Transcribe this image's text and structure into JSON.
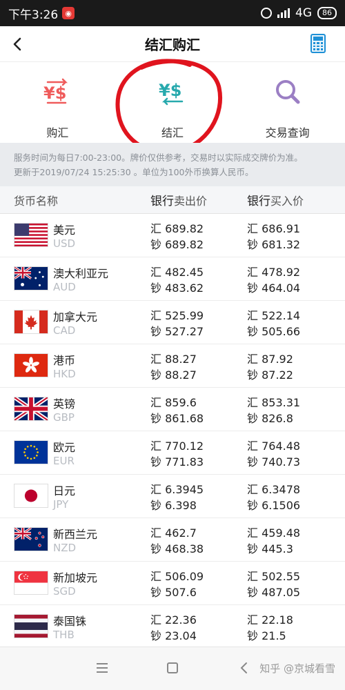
{
  "status": {
    "time": "下午3:26",
    "network": "4G",
    "battery": "86"
  },
  "header": {
    "title": "结汇购汇"
  },
  "actions": [
    {
      "label": "购汇",
      "icon": "buy-currency-icon",
      "glyph": "¥$"
    },
    {
      "label": "结汇",
      "icon": "sell-currency-icon",
      "glyph": "¥$"
    },
    {
      "label": "交易查询",
      "icon": "search-icon"
    }
  ],
  "notice": {
    "line1": "服务时间为每日7:00-23:00。牌价仅供参考，交易时以实际成交牌价为准。",
    "line2": "更新于2019/07/24 15:25:30 。单位为100外币换算人民币。"
  },
  "table": {
    "headers": {
      "name": "货币名称",
      "sell_prefix": "银行",
      "sell_suffix": "卖出价",
      "buy_prefix": "银行",
      "buy_suffix": "买入价"
    },
    "remit_prefix": "汇",
    "cash_prefix": "钞",
    "rows": [
      {
        "name": "美元",
        "code": "USD",
        "sell_remit": "689.82",
        "sell_cash": "689.82",
        "buy_remit": "686.91",
        "buy_cash": "681.32"
      },
      {
        "name": "澳大利亚元",
        "code": "AUD",
        "sell_remit": "482.45",
        "sell_cash": "483.62",
        "buy_remit": "478.92",
        "buy_cash": "464.04"
      },
      {
        "name": "加拿大元",
        "code": "CAD",
        "sell_remit": "525.99",
        "sell_cash": "527.27",
        "buy_remit": "522.14",
        "buy_cash": "505.66"
      },
      {
        "name": "港币",
        "code": "HKD",
        "sell_remit": "88.27",
        "sell_cash": "88.27",
        "buy_remit": "87.92",
        "buy_cash": "87.22"
      },
      {
        "name": "英镑",
        "code": "GBP",
        "sell_remit": "859.6",
        "sell_cash": "861.68",
        "buy_remit": "853.31",
        "buy_cash": "826.8"
      },
      {
        "name": "欧元",
        "code": "EUR",
        "sell_remit": "770.12",
        "sell_cash": "771.83",
        "buy_remit": "764.48",
        "buy_cash": "740.73"
      },
      {
        "name": "日元",
        "code": "JPY",
        "sell_remit": "6.3945",
        "sell_cash": "6.398",
        "buy_remit": "6.3478",
        "buy_cash": "6.1506"
      },
      {
        "name": "新西兰元",
        "code": "NZD",
        "sell_remit": "462.7",
        "sell_cash": "468.38",
        "buy_remit": "459.48",
        "buy_cash": "445.3"
      },
      {
        "name": "新加坡元",
        "code": "SGD",
        "sell_remit": "506.09",
        "sell_cash": "507.6",
        "buy_remit": "502.55",
        "buy_cash": "487.05"
      },
      {
        "name": "泰国铢",
        "code": "THB",
        "sell_remit": "22.36",
        "sell_cash": "23.04",
        "buy_remit": "22.18",
        "buy_cash": "21.5"
      }
    ]
  },
  "watermark": "知乎 @京城看雪",
  "colors": {
    "accent_blue": "#1e90d6",
    "buy_red": "#ef5b5b",
    "sell_teal": "#27a9ad",
    "search_purple": "#9b7fc4",
    "annotation_red": "#e0141e"
  }
}
